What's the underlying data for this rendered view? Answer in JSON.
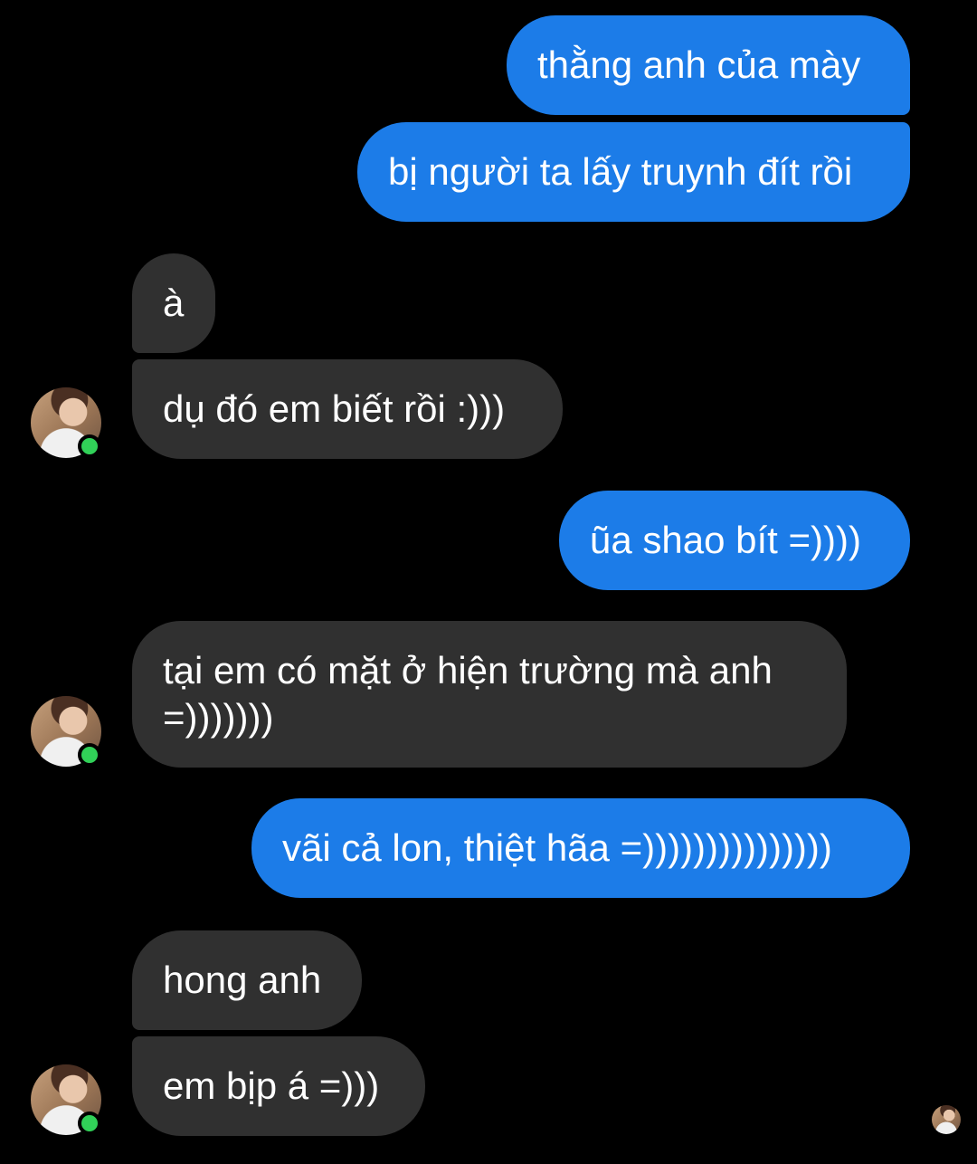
{
  "colors": {
    "background": "#000000",
    "outgoing_bubble": "#1c7ce8",
    "incoming_bubble": "#303030",
    "online_indicator": "#31d158"
  },
  "messages": [
    {
      "direction": "outgoing",
      "text": "thằng anh của mày"
    },
    {
      "direction": "outgoing",
      "text": "bị người ta lấy truynh đít rồi"
    },
    {
      "direction": "incoming",
      "text": "à"
    },
    {
      "direction": "incoming",
      "text": "dụ đó em biết rồi :)))"
    },
    {
      "direction": "outgoing",
      "text": "ũa shao bít =))))"
    },
    {
      "direction": "incoming",
      "text": "tại em có mặt ở hiện trường mà anh =)))))))"
    },
    {
      "direction": "outgoing",
      "text": "vãi cả lon, thiệt hãa =)))))))))))))))"
    },
    {
      "direction": "incoming",
      "text": "hong anh"
    },
    {
      "direction": "incoming",
      "text": "em bịp á =)))"
    }
  ],
  "avatar_icon": "contact-avatar",
  "seen_icon": "seen-receipt-avatar"
}
